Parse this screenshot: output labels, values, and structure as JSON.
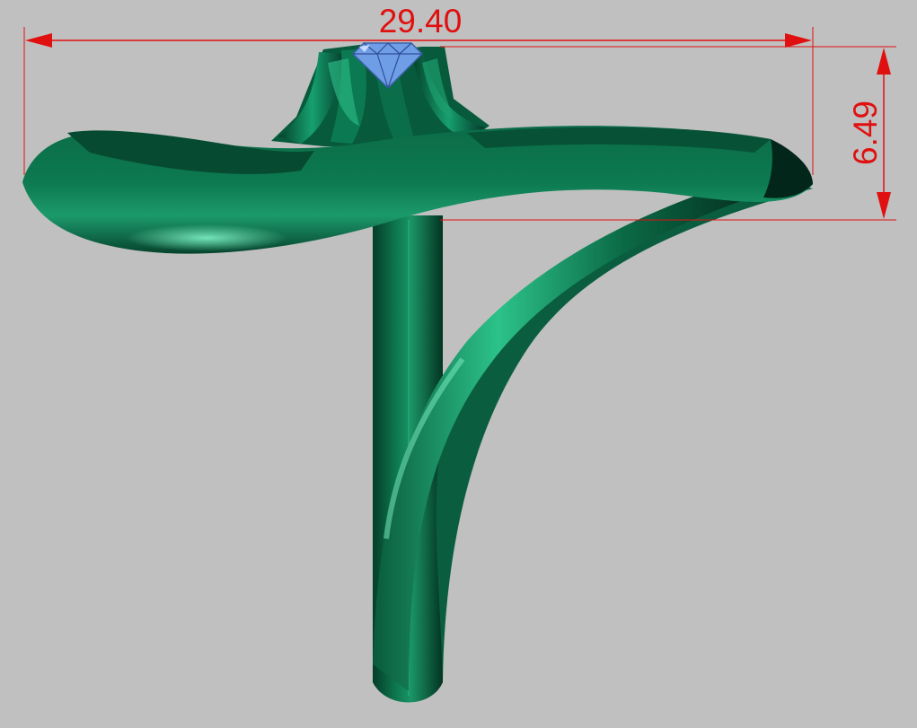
{
  "viewport": {
    "background": "#c0c0c0",
    "subject": "ring-model"
  },
  "dimensions": {
    "width_label": "29.40",
    "height_label": "6.49",
    "color": "#e01010"
  },
  "model": {
    "metal_color": "#0a6b4a",
    "gem_color": "#6f9ee6"
  }
}
